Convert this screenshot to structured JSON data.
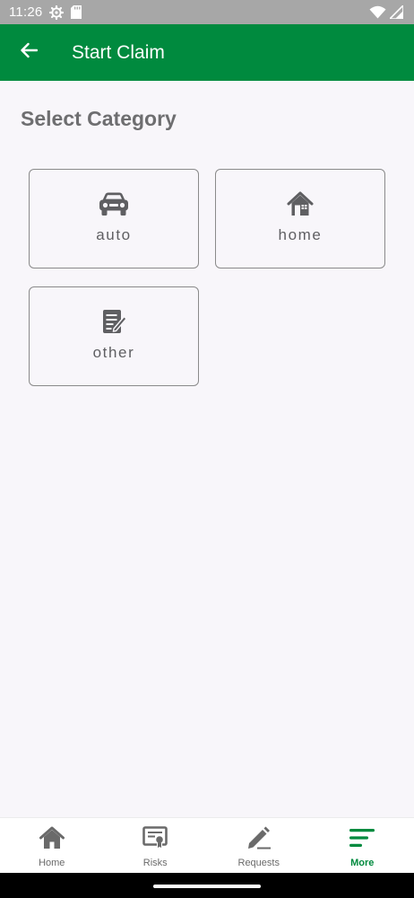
{
  "status_bar": {
    "time": "11:26",
    "icons": [
      "settings-icon",
      "sd-card-icon",
      "wifi-icon",
      "signal-icon"
    ]
  },
  "app_bar": {
    "title": "Start Claim",
    "back_icon": "arrow-left-icon",
    "background_color": "#008a3e"
  },
  "main": {
    "section_title": "Select Category",
    "categories": [
      {
        "label": "auto",
        "icon": "car-icon"
      },
      {
        "label": "home",
        "icon": "house-icon"
      },
      {
        "label": "other",
        "icon": "document-edit-icon"
      }
    ]
  },
  "bottom_nav": {
    "items": [
      {
        "label": "Home",
        "icon": "home-icon",
        "active": false
      },
      {
        "label": "Risks",
        "icon": "certificate-icon",
        "active": false
      },
      {
        "label": "Requests",
        "icon": "pencil-icon",
        "active": false
      },
      {
        "label": "More",
        "icon": "menu-lines-icon",
        "active": true
      }
    ],
    "active_color": "#008a3e",
    "inactive_color": "#6a6a6a"
  }
}
